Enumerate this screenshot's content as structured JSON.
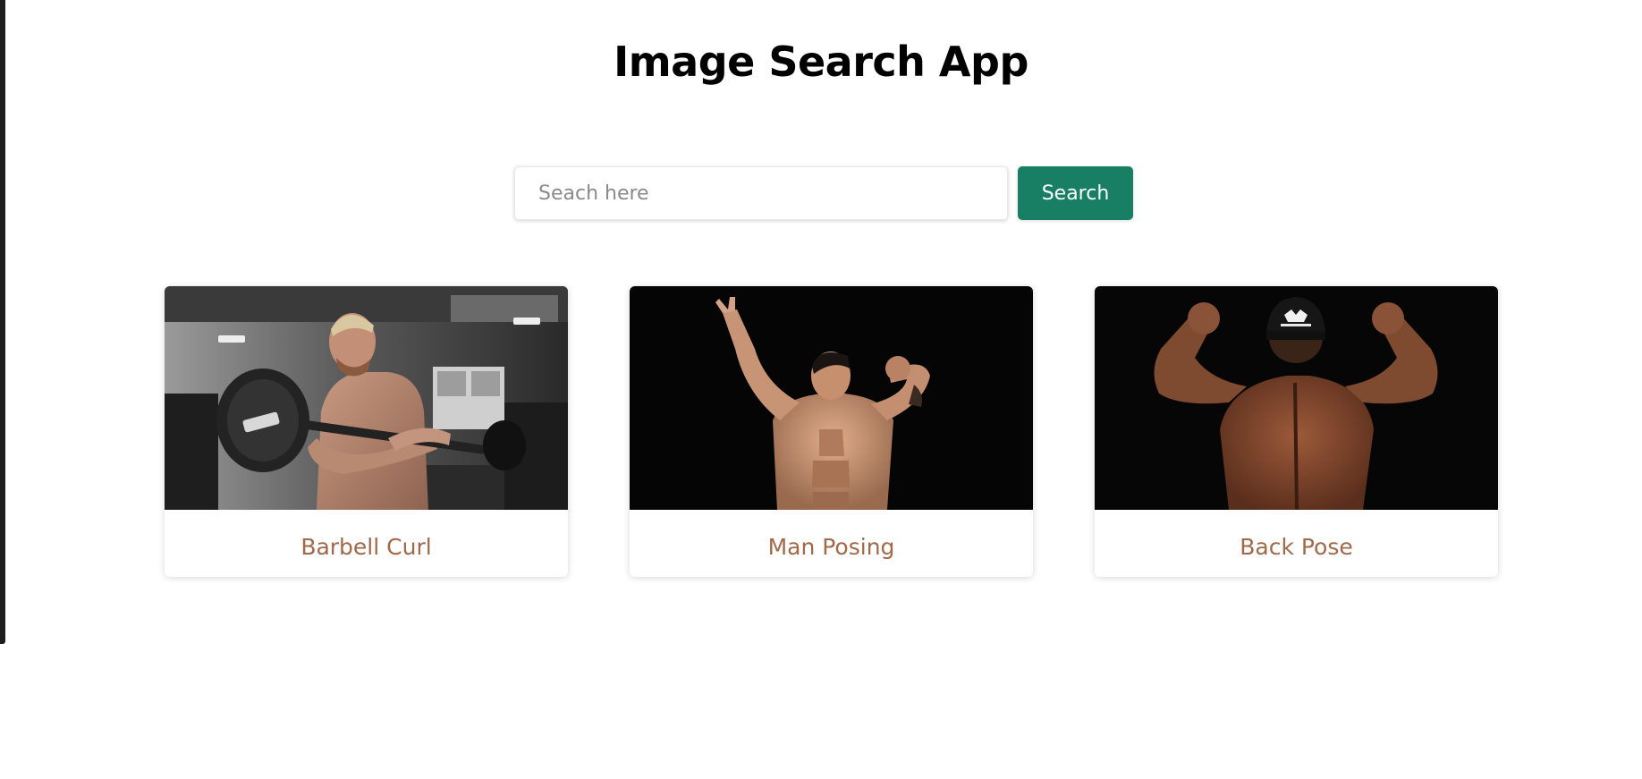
{
  "header": {
    "title": "Image Search App"
  },
  "search": {
    "placeholder": "Seach here",
    "value": "",
    "button_label": "Search"
  },
  "results": [
    {
      "caption": "Barbell Curl",
      "image": "man-curling-barbell-in-gym"
    },
    {
      "caption": "Man Posing",
      "image": "man-flexing-front-pose-black-background"
    },
    {
      "caption": "Back Pose",
      "image": "man-flexing-back-pose-black-background"
    }
  ],
  "colors": {
    "button": "#187f64",
    "caption": "#a0694a",
    "title": "#000000"
  }
}
